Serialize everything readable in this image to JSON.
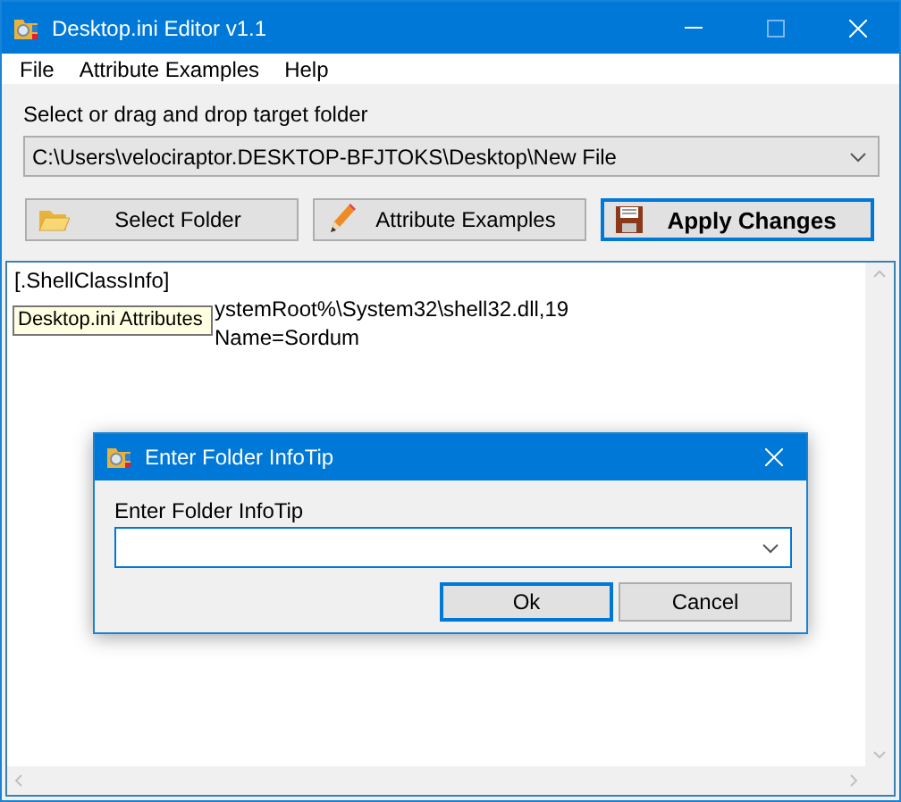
{
  "window": {
    "title": "Desktop.ini Editor v1.1"
  },
  "menu": [
    {
      "label": "File"
    },
    {
      "label": "Attribute Examples"
    },
    {
      "label": "Help"
    }
  ],
  "folder_label": "Select or drag and drop target folder",
  "folder_path": "C:\\Users\\velociraptor.DESKTOP-BFJTOKS\\Desktop\\New File",
  "buttons": [
    {
      "label": "Select Folder",
      "kind": "folder",
      "default": false
    },
    {
      "label": "Attribute Examples",
      "kind": "pencil",
      "default": false
    },
    {
      "label": "Apply Changes",
      "kind": "floppy",
      "default": true
    }
  ],
  "editor_lines": [
    {
      "text": "[.ShellClassInfo]",
      "kind": "full"
    },
    {
      "text": "ystemRoot%\\System32\\shell32.dll,19",
      "kind": "behind_tooltip"
    },
    {
      "text": "Name=Sordum",
      "kind": "behind_tooltip"
    }
  ],
  "tooltip": "Desktop.ini Attributes",
  "dialog": {
    "title": "Enter Folder InfoTip",
    "label": "Enter Folder InfoTip",
    "buttons": [
      {
        "label": "Ok",
        "default": true
      },
      {
        "label": "Cancel",
        "default": false
      }
    ]
  }
}
